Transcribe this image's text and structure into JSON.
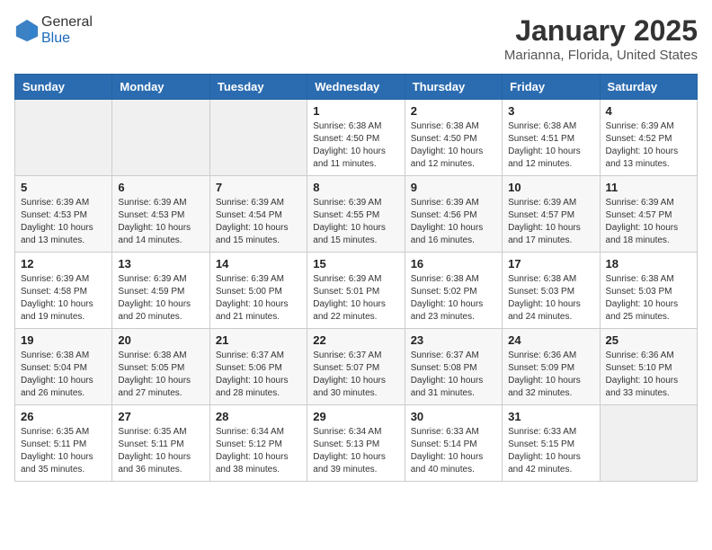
{
  "header": {
    "logo_general": "General",
    "logo_blue": "Blue",
    "month_title": "January 2025",
    "location": "Marianna, Florida, United States"
  },
  "weekdays": [
    "Sunday",
    "Monday",
    "Tuesday",
    "Wednesday",
    "Thursday",
    "Friday",
    "Saturday"
  ],
  "weeks": [
    [
      {
        "day": "",
        "sunrise": "",
        "sunset": "",
        "daylight": ""
      },
      {
        "day": "",
        "sunrise": "",
        "sunset": "",
        "daylight": ""
      },
      {
        "day": "",
        "sunrise": "",
        "sunset": "",
        "daylight": ""
      },
      {
        "day": "1",
        "sunrise": "6:38 AM",
        "sunset": "4:50 PM",
        "daylight": "10 hours and 11 minutes."
      },
      {
        "day": "2",
        "sunrise": "6:38 AM",
        "sunset": "4:50 PM",
        "daylight": "10 hours and 12 minutes."
      },
      {
        "day": "3",
        "sunrise": "6:38 AM",
        "sunset": "4:51 PM",
        "daylight": "10 hours and 12 minutes."
      },
      {
        "day": "4",
        "sunrise": "6:39 AM",
        "sunset": "4:52 PM",
        "daylight": "10 hours and 13 minutes."
      }
    ],
    [
      {
        "day": "5",
        "sunrise": "6:39 AM",
        "sunset": "4:53 PM",
        "daylight": "10 hours and 13 minutes."
      },
      {
        "day": "6",
        "sunrise": "6:39 AM",
        "sunset": "4:53 PM",
        "daylight": "10 hours and 14 minutes."
      },
      {
        "day": "7",
        "sunrise": "6:39 AM",
        "sunset": "4:54 PM",
        "daylight": "10 hours and 15 minutes."
      },
      {
        "day": "8",
        "sunrise": "6:39 AM",
        "sunset": "4:55 PM",
        "daylight": "10 hours and 15 minutes."
      },
      {
        "day": "9",
        "sunrise": "6:39 AM",
        "sunset": "4:56 PM",
        "daylight": "10 hours and 16 minutes."
      },
      {
        "day": "10",
        "sunrise": "6:39 AM",
        "sunset": "4:57 PM",
        "daylight": "10 hours and 17 minutes."
      },
      {
        "day": "11",
        "sunrise": "6:39 AM",
        "sunset": "4:57 PM",
        "daylight": "10 hours and 18 minutes."
      }
    ],
    [
      {
        "day": "12",
        "sunrise": "6:39 AM",
        "sunset": "4:58 PM",
        "daylight": "10 hours and 19 minutes."
      },
      {
        "day": "13",
        "sunrise": "6:39 AM",
        "sunset": "4:59 PM",
        "daylight": "10 hours and 20 minutes."
      },
      {
        "day": "14",
        "sunrise": "6:39 AM",
        "sunset": "5:00 PM",
        "daylight": "10 hours and 21 minutes."
      },
      {
        "day": "15",
        "sunrise": "6:39 AM",
        "sunset": "5:01 PM",
        "daylight": "10 hours and 22 minutes."
      },
      {
        "day": "16",
        "sunrise": "6:38 AM",
        "sunset": "5:02 PM",
        "daylight": "10 hours and 23 minutes."
      },
      {
        "day": "17",
        "sunrise": "6:38 AM",
        "sunset": "5:03 PM",
        "daylight": "10 hours and 24 minutes."
      },
      {
        "day": "18",
        "sunrise": "6:38 AM",
        "sunset": "5:03 PM",
        "daylight": "10 hours and 25 minutes."
      }
    ],
    [
      {
        "day": "19",
        "sunrise": "6:38 AM",
        "sunset": "5:04 PM",
        "daylight": "10 hours and 26 minutes."
      },
      {
        "day": "20",
        "sunrise": "6:38 AM",
        "sunset": "5:05 PM",
        "daylight": "10 hours and 27 minutes."
      },
      {
        "day": "21",
        "sunrise": "6:37 AM",
        "sunset": "5:06 PM",
        "daylight": "10 hours and 28 minutes."
      },
      {
        "day": "22",
        "sunrise": "6:37 AM",
        "sunset": "5:07 PM",
        "daylight": "10 hours and 30 minutes."
      },
      {
        "day": "23",
        "sunrise": "6:37 AM",
        "sunset": "5:08 PM",
        "daylight": "10 hours and 31 minutes."
      },
      {
        "day": "24",
        "sunrise": "6:36 AM",
        "sunset": "5:09 PM",
        "daylight": "10 hours and 32 minutes."
      },
      {
        "day": "25",
        "sunrise": "6:36 AM",
        "sunset": "5:10 PM",
        "daylight": "10 hours and 33 minutes."
      }
    ],
    [
      {
        "day": "26",
        "sunrise": "6:35 AM",
        "sunset": "5:11 PM",
        "daylight": "10 hours and 35 minutes."
      },
      {
        "day": "27",
        "sunrise": "6:35 AM",
        "sunset": "5:11 PM",
        "daylight": "10 hours and 36 minutes."
      },
      {
        "day": "28",
        "sunrise": "6:34 AM",
        "sunset": "5:12 PM",
        "daylight": "10 hours and 38 minutes."
      },
      {
        "day": "29",
        "sunrise": "6:34 AM",
        "sunset": "5:13 PM",
        "daylight": "10 hours and 39 minutes."
      },
      {
        "day": "30",
        "sunrise": "6:33 AM",
        "sunset": "5:14 PM",
        "daylight": "10 hours and 40 minutes."
      },
      {
        "day": "31",
        "sunrise": "6:33 AM",
        "sunset": "5:15 PM",
        "daylight": "10 hours and 42 minutes."
      },
      {
        "day": "",
        "sunrise": "",
        "sunset": "",
        "daylight": ""
      }
    ]
  ]
}
